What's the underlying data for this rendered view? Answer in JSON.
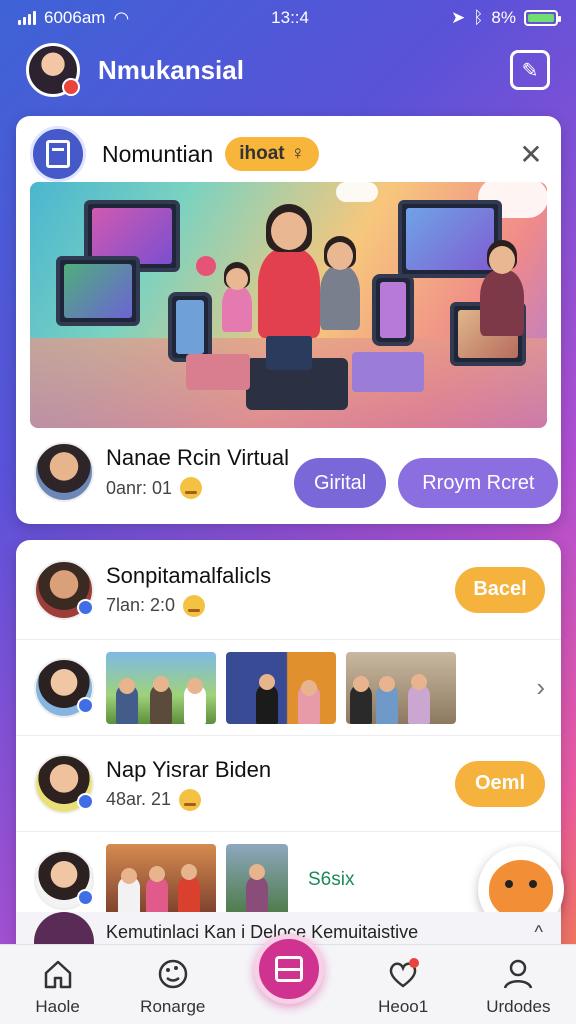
{
  "status_bar": {
    "carrier": "6006am",
    "time": "13::4",
    "battery": "8%"
  },
  "header": {
    "title": "Nmukansial"
  },
  "card1": {
    "title": "Nomuntian",
    "pill_label": "ihoat",
    "row": {
      "name": "Nanae Rcin Virtual",
      "meta": "0anr: 01",
      "btn_primary": "Girital",
      "btn_secondary": "Rroym Rcret"
    }
  },
  "card2": {
    "row1": {
      "name": "Sonpitamalfalicls",
      "meta": "7lan: 2:0",
      "button": "Bacel"
    },
    "row3": {
      "name": "Nap Yisrar Biden",
      "meta": "48ar. 21",
      "button": "Oeml"
    },
    "row4": {
      "tag": "S6six"
    }
  },
  "peek": {
    "text": "Kemutinlaci Kan  i Deloce Kemuitaistive"
  },
  "tabs": [
    {
      "label": "Haole"
    },
    {
      "label": "Ronarge"
    },
    {
      "label": ""
    },
    {
      "label": "Heoo1"
    },
    {
      "label": "Urdodes"
    }
  ],
  "colors": {
    "accent": "#d0338f",
    "primary": "#7a68d8",
    "orange": "#f5b23d"
  }
}
